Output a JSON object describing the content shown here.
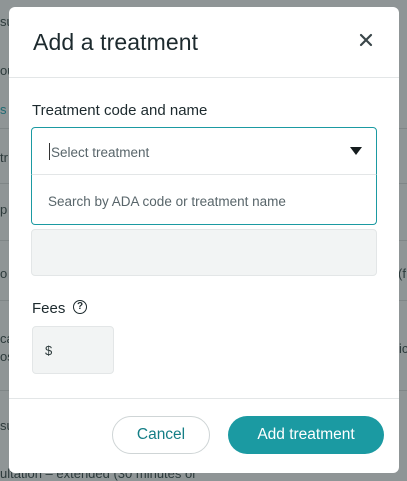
{
  "background": {
    "fragments": [
      "su",
      "ou",
      "s",
      "tr",
      "p",
      "o",
      "(f",
      "ca",
      "os",
      "ic",
      "su",
      "ultation – extended (30 minutes or"
    ]
  },
  "modal": {
    "title": "Add a treatment",
    "close_icon": "close-icon",
    "treatment_label": "Treatment code and name",
    "select_placeholder": "Select treatment",
    "dropdown_hint": "Search by ADA code or treatment name",
    "fees_label": "Fees",
    "help_icon": "question-circle-icon",
    "help_glyph": "?",
    "currency_symbol": "$",
    "cancel_label": "Cancel",
    "add_label": "Add treatment"
  },
  "colors": {
    "accent": "#1b9aa2",
    "overlay": "#8f9596",
    "text": "#1d2a2e"
  }
}
